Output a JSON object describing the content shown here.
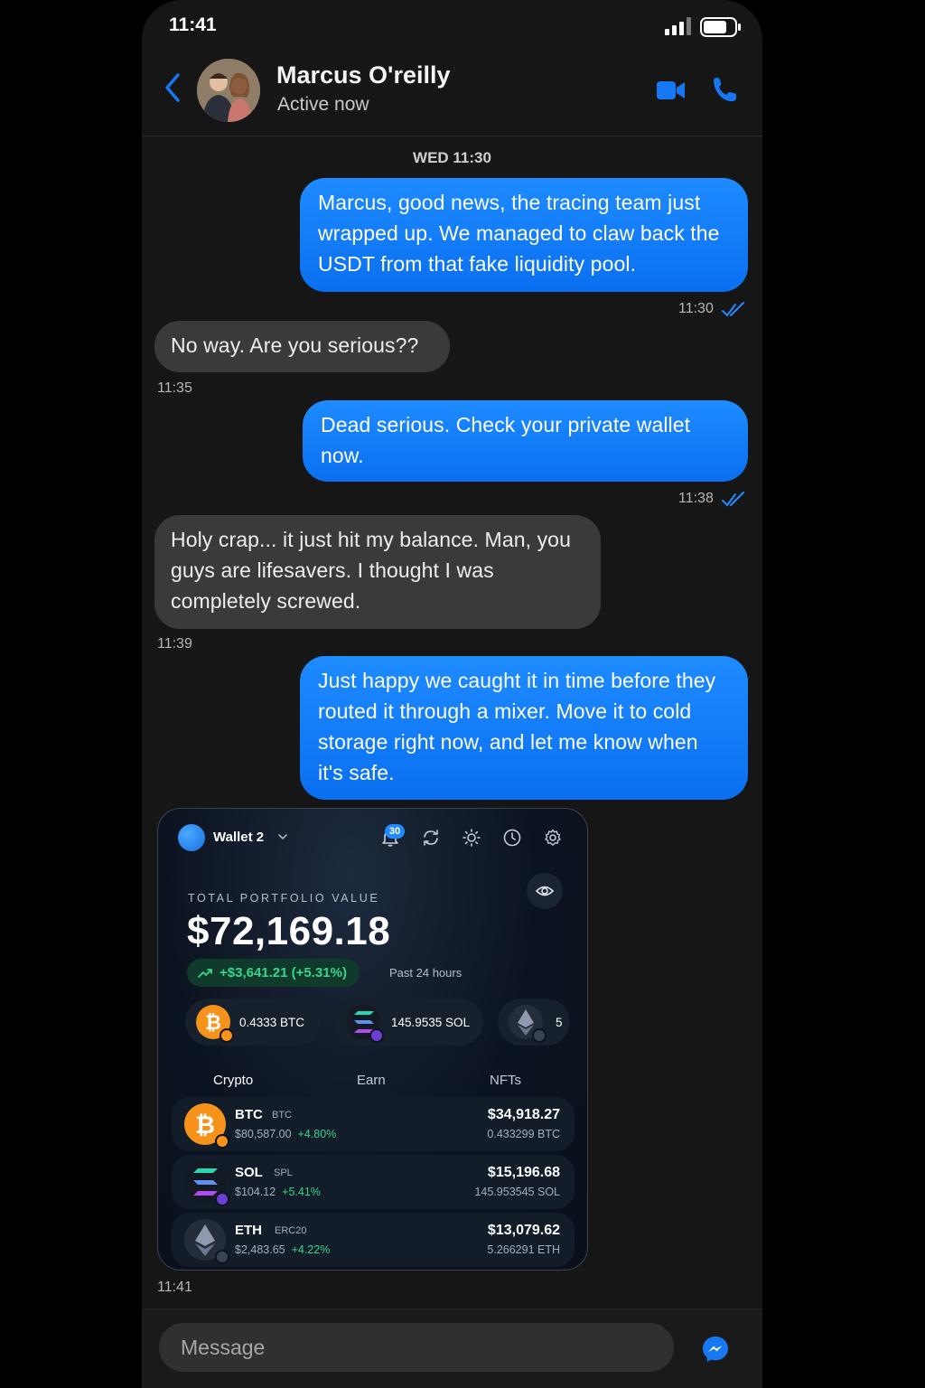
{
  "status_bar": {
    "time": "11:41"
  },
  "header": {
    "name": "Marcus O'reilly",
    "status": "Active now"
  },
  "day_label": "WED 11:30",
  "messages": [
    {
      "dir": "out",
      "text": "Marcus, good news, the tracing team just wrapped up. We managed to claw back the USDT from that fake liquidity pool.",
      "time": "11:30"
    },
    {
      "dir": "in",
      "text": "No way. Are you serious??",
      "time": "11:35"
    },
    {
      "dir": "out",
      "text": "Dead serious. Check your private wallet now.",
      "time": "11:38"
    },
    {
      "dir": "in",
      "text": "Holy crap... it just hit my balance. Man, you guys are lifesavers. I thought I was completely screwed.",
      "time": "11:39"
    },
    {
      "dir": "out",
      "text": "Just happy we caught it in time before they routed it through a mixer. Move it to cold storage right now, and let me know when it's safe.",
      "time": ""
    }
  ],
  "image_time": "11:41",
  "wallet": {
    "name": "Wallet 2",
    "notification_count": "30",
    "portfolio_label": "TOTAL PORTFOLIO VALUE",
    "portfolio_value": "$72,169.18",
    "change": "+$3,641.21 (+5.31%)",
    "change_period": "Past 24 hours",
    "chips": [
      {
        "coin": "BTC",
        "text": "0.4333 BTC"
      },
      {
        "coin": "SOL",
        "text": "145.9535 SOL"
      },
      {
        "coin": "ETH",
        "text": "5"
      }
    ],
    "tabs": [
      "Crypto",
      "Earn",
      "NFTs"
    ],
    "assets": [
      {
        "symbol": "BTC",
        "chain": "BTC",
        "price": "$80,587.00",
        "change": "+4.80%",
        "value": "$34,918.27",
        "amount": "0.433299 BTC"
      },
      {
        "symbol": "SOL",
        "chain": "SPL",
        "price": "$104.12",
        "change": "+5.41%",
        "value": "$15,196.68",
        "amount": "145.953545 SOL"
      },
      {
        "symbol": "ETH",
        "chain": "ERC20",
        "price": "$2,483.65",
        "change": "+4.22%",
        "value": "$13,079.62",
        "amount": "5.266291 ETH"
      }
    ],
    "colors": {
      "btc": "#f7931a",
      "positive": "#37d68a",
      "accent": "#1f8bff"
    }
  },
  "composer": {
    "placeholder": "Message"
  },
  "colors": {
    "bubble_out": "#0a6ff0",
    "bubble_in": "#3a3a3a",
    "accent": "#1877f2"
  }
}
